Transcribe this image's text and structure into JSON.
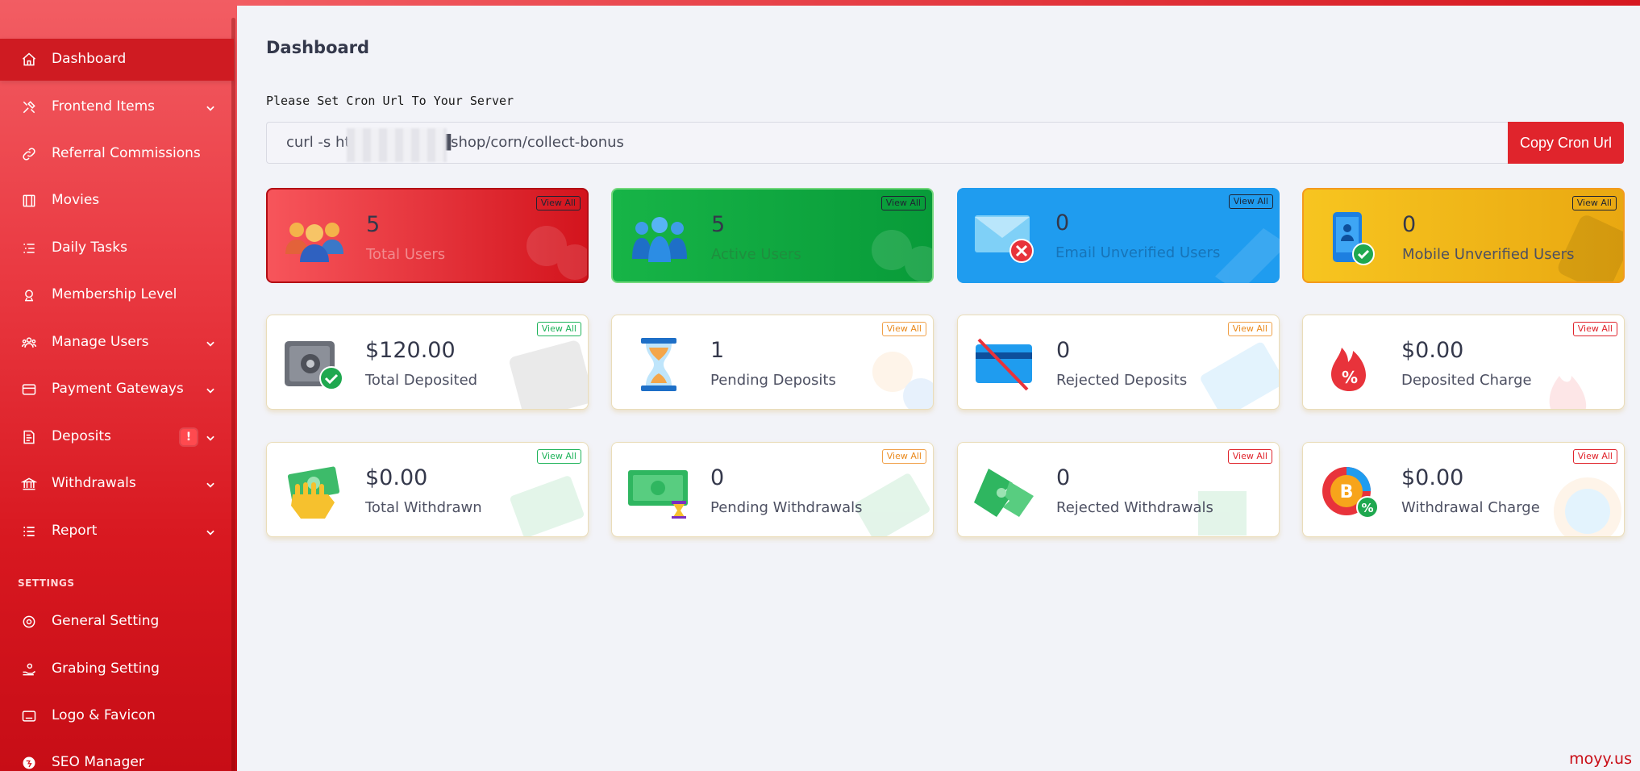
{
  "sidebar": {
    "items": [
      {
        "label": "Dashboard",
        "icon": "home-icon"
      },
      {
        "label": "Frontend Items",
        "icon": "tools-icon"
      },
      {
        "label": "Referral Commissions",
        "icon": "link-icon"
      },
      {
        "label": "Movies",
        "icon": "film-icon"
      },
      {
        "label": "Daily Tasks",
        "icon": "list-icon"
      },
      {
        "label": "Membership Level",
        "icon": "user-badge-icon"
      },
      {
        "label": "Manage Users",
        "icon": "users-icon"
      },
      {
        "label": "Payment Gateways",
        "icon": "card-icon"
      },
      {
        "label": "Deposits",
        "icon": "receipt-icon",
        "badge": "!"
      },
      {
        "label": "Withdrawals",
        "icon": "bank-icon"
      },
      {
        "label": "Report",
        "icon": "report-list-icon"
      },
      {
        "label": "General Setting",
        "icon": "gear-ring-icon"
      },
      {
        "label": "Grabing Setting",
        "icon": "hand-coin-icon"
      },
      {
        "label": "Logo & Favicon",
        "icon": "image-icon"
      },
      {
        "label": "SEO Manager",
        "icon": "globe-icon"
      }
    ],
    "section_settings": "SETTINGS"
  },
  "page": {
    "title": "Dashboard",
    "cron_label": "Please Set Cron Url To Your Server",
    "cron_value": "curl -s ht█████████shop/corn/collect-bonus",
    "copy_button": "Copy Cron Url"
  },
  "view_all": "View All",
  "cards": [
    {
      "value": "5",
      "label": "Total Users",
      "icon": "users-group-icon"
    },
    {
      "value": "5",
      "label": "Active Users",
      "icon": "active-users-icon"
    },
    {
      "value": "0",
      "label": "Email Unverified Users",
      "icon": "email-unverified-icon"
    },
    {
      "value": "0",
      "label": "Mobile Unverified Users",
      "icon": "mobile-unverified-icon"
    },
    {
      "value": "$120.00",
      "label": "Total Deposited",
      "icon": "safe-check-icon"
    },
    {
      "value": "1",
      "label": "Pending Deposits",
      "icon": "hourglass-icon"
    },
    {
      "value": "0",
      "label": "Rejected Deposits",
      "icon": "card-rejected-icon"
    },
    {
      "value": "$0.00",
      "label": "Deposited Charge",
      "icon": "percent-flame-icon"
    },
    {
      "value": "$0.00",
      "label": "Total Withdrawn",
      "icon": "hand-cash-icon"
    },
    {
      "value": "0",
      "label": "Pending Withdrawals",
      "icon": "cash-hourglass-icon"
    },
    {
      "value": "0",
      "label": "Rejected Withdrawals",
      "icon": "torn-cash-icon"
    },
    {
      "value": "$0.00",
      "label": "Withdrawal Charge",
      "icon": "bitcoin-percent-icon"
    }
  ],
  "watermark": "moyy.us",
  "colors": {
    "accent_red": "#e0242c",
    "card_green": "#089b39",
    "card_blue": "#1f9cef",
    "card_yellow": "#f7c520"
  }
}
